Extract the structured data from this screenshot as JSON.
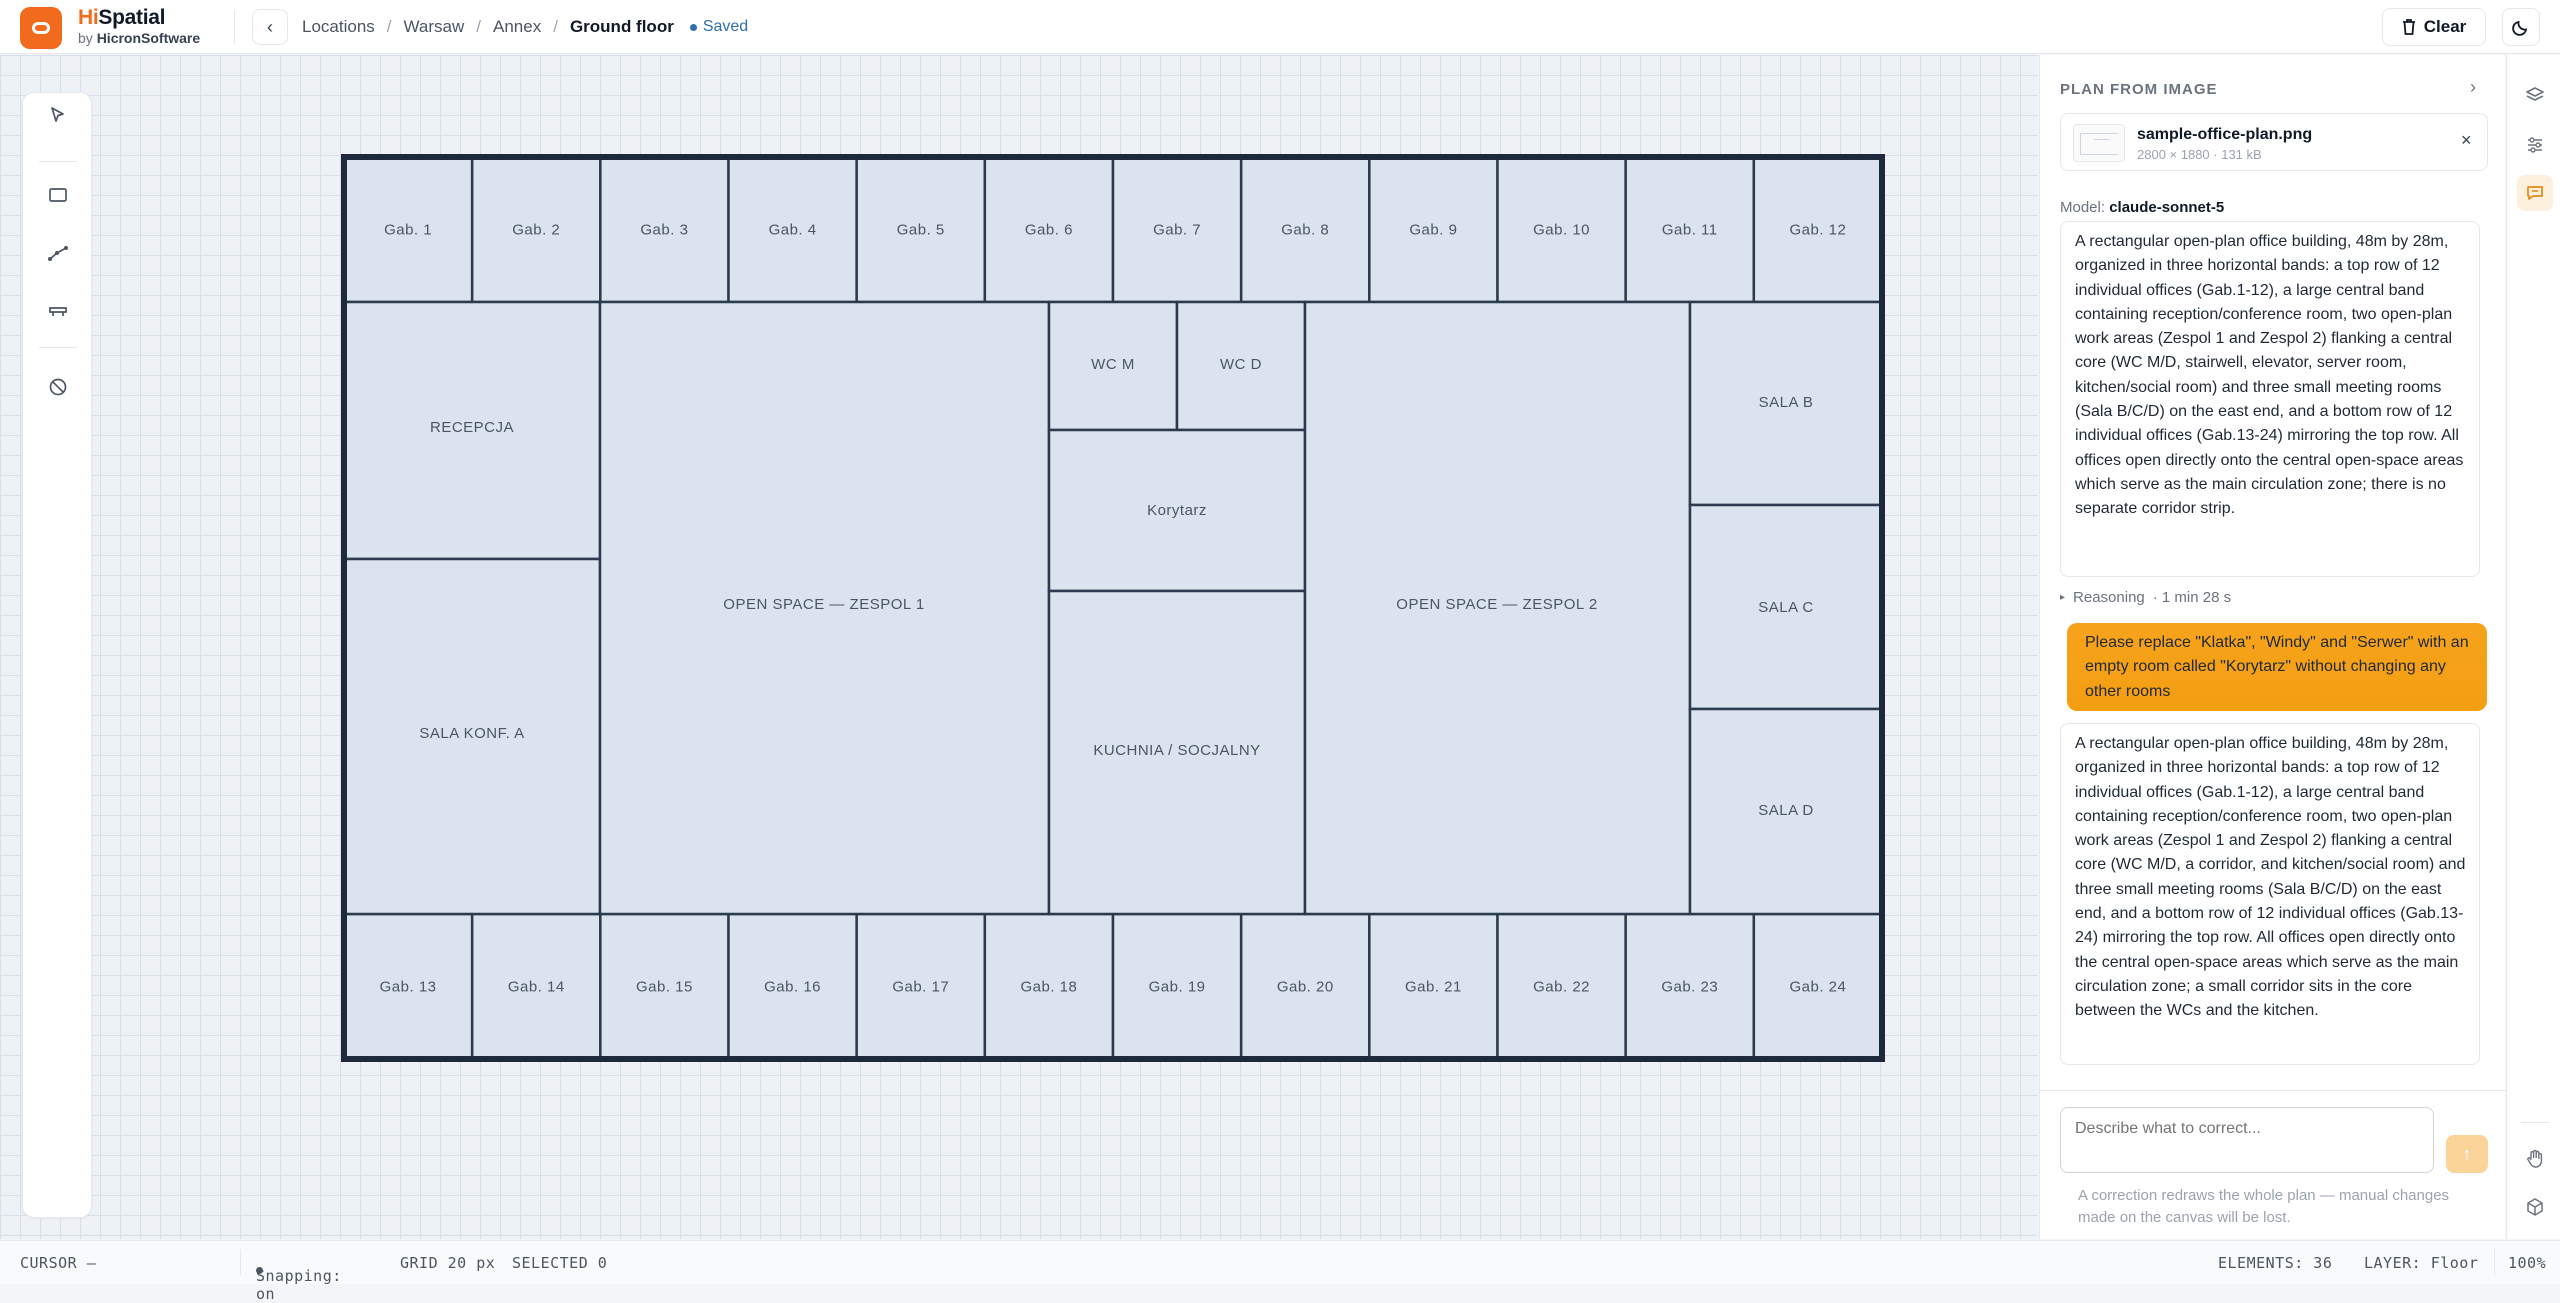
{
  "app": {
    "brand_prefix": "Hi",
    "brand_suffix": "Spatial",
    "by_prefix": "by",
    "by_company": "HicronSoftware"
  },
  "header": {
    "breadcrumb": [
      "Locations",
      "Warsaw",
      "Annex",
      "Ground floor"
    ],
    "saved_label": "Saved",
    "clear_label": "Clear"
  },
  "plan": {
    "top_offices": [
      "Gab. 1",
      "Gab. 2",
      "Gab. 3",
      "Gab. 4",
      "Gab. 5",
      "Gab. 6",
      "Gab. 7",
      "Gab. 8",
      "Gab. 9",
      "Gab. 10",
      "Gab. 11",
      "Gab. 12"
    ],
    "bottom_offices": [
      "Gab. 13",
      "Gab. 14",
      "Gab. 15",
      "Gab. 16",
      "Gab. 17",
      "Gab. 18",
      "Gab. 19",
      "Gab. 20",
      "Gab. 21",
      "Gab. 22",
      "Gab. 23",
      "Gab. 24"
    ],
    "recepcja": "RECEPCJA",
    "sala_konf_a": "SALA KONF. A",
    "zespol_1": "OPEN SPACE — ZESPOL 1",
    "wc_m": "WC M",
    "wc_d": "WC D",
    "korytarz": "Korytarz",
    "kuchnia": "KUCHNIA / SOCJALNY",
    "zespol_2": "OPEN SPACE — ZESPOL 2",
    "sala_b": "SALA B",
    "sala_c": "SALA C",
    "sala_d": "SALA D"
  },
  "panel": {
    "title": "PLAN FROM IMAGE",
    "file_name": "sample-office-plan.png",
    "file_meta": "2800 × 1880 · 131 kB",
    "model_label": "Model:",
    "model_name": "claude-sonnet-5",
    "assistant_msg_1": "A rectangular open-plan office building, 48m by 28m, organized in three horizontal bands: a top row of 12 individual offices (Gab.1-12), a large central band containing reception/conference room, two open-plan work areas (Zespol 1 and Zespol 2) flanking a central core (WC M/D, stairwell, elevator, server room, kitchen/social room) and three small meeting rooms (Sala B/C/D) on the east end, and a bottom row of 12 individual offices (Gab.13-24) mirroring the top row. All offices open directly onto the central open-space areas which serve as the main circulation zone; there is no separate corridor strip.",
    "reasoning_label": "Reasoning",
    "reasoning_time": "· 1 min 28 s",
    "user_msg": "Please replace \"Klatka\", \"Windy\" and \"Serwer\" with an empty room called \"Korytarz\" without changing any other rooms",
    "assistant_msg_2": "A rectangular open-plan office building, 48m by 28m, organized in three horizontal bands: a top row of 12 individual offices (Gab.1-12), a large central band containing reception/conference room, two open-plan work areas (Zespol 1 and Zespol 2) flanking a central core (WC M/D, a corridor, and kitchen/social room) and three small meeting rooms (Sala B/C/D) on the east end, and a bottom row of 12 individual offices (Gab.13-24) mirroring the top row. All offices open directly onto the central open-space areas which serve as the main circulation zone; a small corridor sits in the core between the WCs and the kitchen.",
    "input_placeholder": "Describe what to correct...",
    "hint": "A correction redraws the whole plan — manual changes made on the canvas will be lost."
  },
  "status": {
    "cursor": "CURSOR —",
    "snapping": "Snapping: on",
    "grid": "GRID 20 px",
    "selected": "SELECTED 0",
    "elements": "ELEMENTS: 36",
    "layer": "LAYER: Floor",
    "zoom": "100%"
  },
  "colors": {
    "accent": "#f26a1b",
    "user_bubble": "#f59e0b",
    "wall": "#1e2a3b",
    "room_fill": "#dbe3ee"
  }
}
